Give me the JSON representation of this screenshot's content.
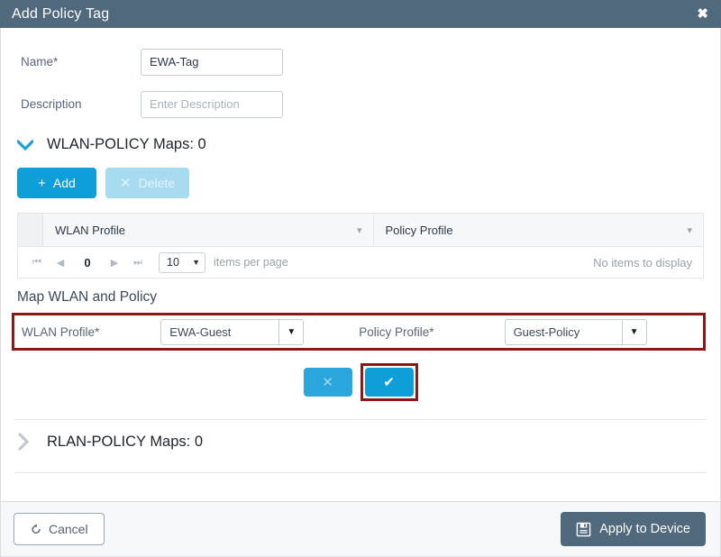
{
  "titlebar": {
    "title": "Add Policy Tag",
    "close_icon": "close-icon"
  },
  "form": {
    "name": {
      "label": "Name*",
      "value": "EWA-Tag",
      "placeholder": ""
    },
    "description": {
      "label": "Description",
      "value": "",
      "placeholder": "Enter Description"
    }
  },
  "wlan_policy_section": {
    "chevron_icon": "chevron-down-icon",
    "title": "WLAN-POLICY Maps: 0",
    "expanded": true,
    "buttons": {
      "add_label": "Add",
      "add_icon": "plus-icon",
      "delete_label": "Delete",
      "delete_icon": "cross-icon",
      "delete_disabled": true
    },
    "grid": {
      "columns": [
        "WLAN Profile",
        "Policy Profile"
      ],
      "rows": [],
      "empty_message": "No items to display",
      "pager": {
        "first_icon": "first-page-icon",
        "prev_icon": "prev-page-icon",
        "page": "0",
        "next_icon": "next-page-icon",
        "last_icon": "last-page-icon",
        "items_per_page_value": "10",
        "items_per_page_label": "items per page"
      }
    }
  },
  "map_section": {
    "title": "Map WLAN and Policy",
    "wlan_profile": {
      "label": "WLAN Profile*",
      "value": "EWA-Guest"
    },
    "policy_profile": {
      "label": "Policy Profile*",
      "value": "Guest-Policy"
    },
    "cancel_map_icon": "cross-icon",
    "confirm_map_icon": "check-icon",
    "highlight_color": "#8d1616"
  },
  "rlan_policy_section": {
    "chevron_icon": "chevron-right-icon",
    "title": "RLAN-POLICY Maps: 0",
    "expanded": false
  },
  "footer": {
    "cancel_label": "Cancel",
    "cancel_icon": "undo-icon",
    "apply_label": "Apply to Device",
    "apply_icon": "save-icon"
  },
  "colors": {
    "header_bg": "#50697d",
    "accent_blue": "#0f9fd8",
    "highlight_red": "#8d1616"
  }
}
